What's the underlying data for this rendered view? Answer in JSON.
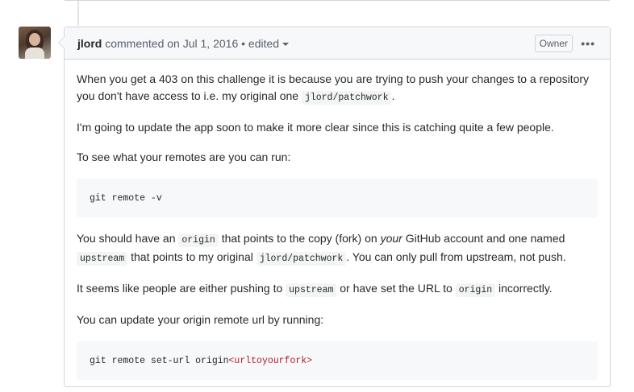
{
  "comment": {
    "author": "jlord",
    "commented_on": "commented on Jul 1, 2016",
    "separator": "•",
    "edited_label": "edited",
    "owner_badge": "Owner",
    "menu_glyph": "•••"
  },
  "body": {
    "p1": {
      "text": "When you get a 403 on this challenge it is because you are trying to push your changes to a repository you don't have access to i.e. my original one",
      "code": "jlord/patchwork",
      "end": "."
    },
    "p2": "I'm going to update the app soon to make it more clear since this is catching quite a few people.",
    "p3": "To see what your remotes are you can run:",
    "code_block_1": "git remote -v",
    "p4": {
      "a": "You should have an",
      "code_origin": "origin",
      "b": "that points to the copy (fork) on",
      "em": "your",
      "c": "GitHub account and one named",
      "code_upstream": "upstream",
      "d": "that points to my original",
      "code_repo": "jlord/patchwork",
      "e": ". You can only pull from upstream, not push."
    },
    "p5": {
      "a": "It seems like people are either pushing to",
      "code_upstream": "upstream",
      "b": "or have set the URL to",
      "code_origin": "origin",
      "c": "incorrectly."
    },
    "p6": "You can update your origin remote url by running:",
    "code_block_2": {
      "cmd": "git remote set-url origin",
      "arg": "<urltoyourfork>"
    }
  }
}
